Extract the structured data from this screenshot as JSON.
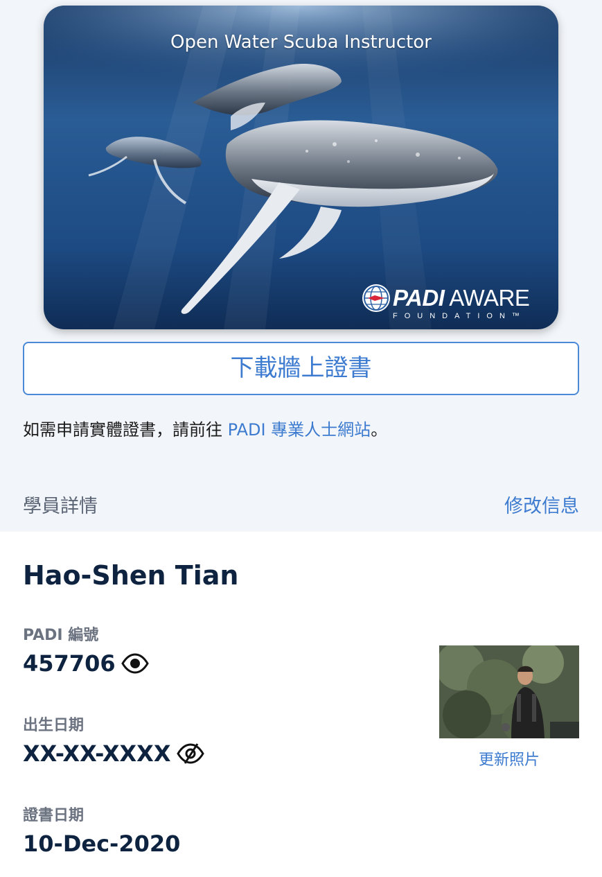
{
  "card": {
    "title": "Open Water Scuba Instructor",
    "logo_brand": "PADI",
    "logo_word": "AWARE",
    "logo_sub": "FOUNDATION™"
  },
  "download_button": "下載牆上證書",
  "note": {
    "prefix": "如需申請實體證書，請前往 ",
    "link": "PADI 專業人士網站",
    "suffix": "。"
  },
  "section": {
    "title": "學員詳情",
    "edit": "修改信息"
  },
  "student": {
    "name": "Hao-Shen Tian",
    "padi_label": "PADI 編號",
    "padi_number": "457706",
    "dob_label": "出生日期",
    "dob_value": "XX-XX-XXXX",
    "cert_label": "證書日期",
    "cert_value": "10-Dec-2020",
    "update_photo": "更新照片"
  },
  "colors": {
    "accent": "#3d7bd0",
    "text_dark": "#0e2340",
    "muted": "#6b7280",
    "panel_bg": "#f2f5f9"
  }
}
